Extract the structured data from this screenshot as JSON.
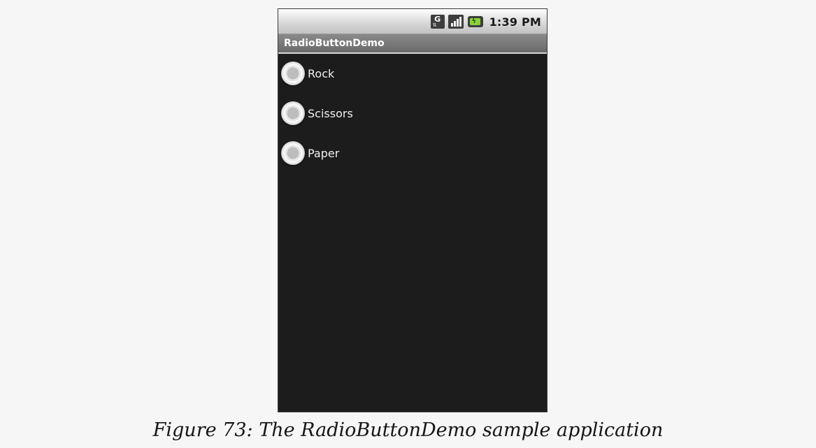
{
  "status_bar": {
    "time": "1:39 PM",
    "icons": [
      "gsm-data-icon",
      "signal-strength-icon",
      "battery-charging-icon"
    ],
    "network_letter": "G"
  },
  "app": {
    "title": "RadioButtonDemo"
  },
  "radio_group": {
    "options": [
      {
        "label": "Rock",
        "checked": false
      },
      {
        "label": "Scissors",
        "checked": false
      },
      {
        "label": "Paper",
        "checked": false
      }
    ]
  },
  "caption": "Figure 73: The RadioButtonDemo sample application",
  "colors": {
    "screen_background": "#1c1c1c",
    "title_bar": "#777777",
    "battery_fill": "#8bd23a"
  }
}
